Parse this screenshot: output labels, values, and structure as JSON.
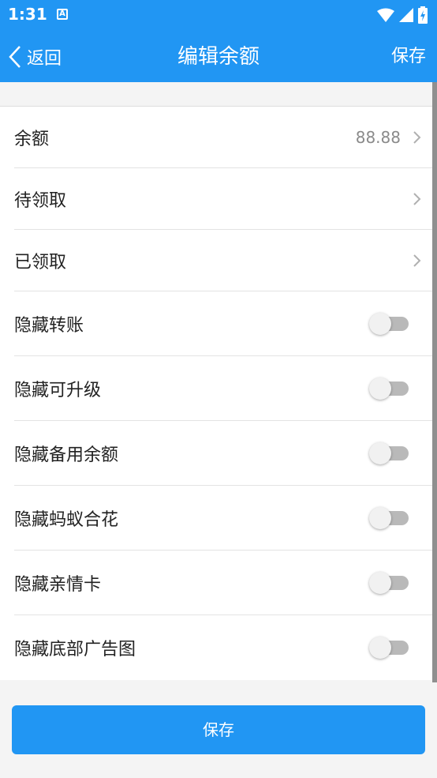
{
  "status_bar": {
    "time": "1:31",
    "notification_icon": "A"
  },
  "app_bar": {
    "back_label": "返回",
    "title": "编辑余额",
    "save_label": "保存"
  },
  "rows": [
    {
      "label": "余额",
      "value": "88.88",
      "kind": "nav"
    },
    {
      "label": "待领取",
      "value": "",
      "kind": "nav"
    },
    {
      "label": "已领取",
      "value": "",
      "kind": "nav"
    },
    {
      "label": "隐藏转账",
      "kind": "toggle",
      "on": false
    },
    {
      "label": "隐藏可升级",
      "kind": "toggle",
      "on": false
    },
    {
      "label": "隐藏备用余额",
      "kind": "toggle",
      "on": false
    },
    {
      "label": "隐藏蚂蚁合花",
      "kind": "toggle",
      "on": false
    },
    {
      "label": "隐藏亲情卡",
      "kind": "toggle",
      "on": false
    },
    {
      "label": "隐藏底部广告图",
      "kind": "toggle",
      "on": false
    }
  ],
  "bottom_button": {
    "label": "保存"
  },
  "colors": {
    "primary": "#2196f3",
    "switch_track_off": "#b9b9b9",
    "switch_thumb_off": "#f1f1f1"
  }
}
